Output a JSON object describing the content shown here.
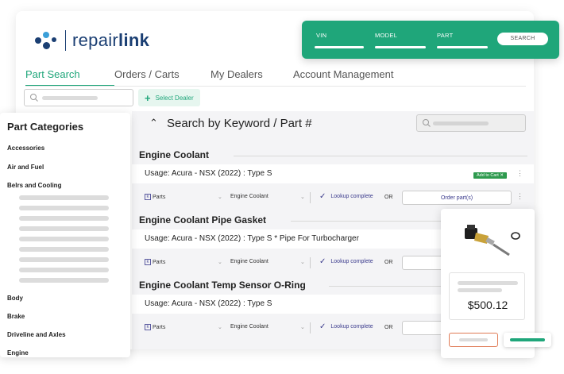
{
  "brand": {
    "name_prefix": "repair",
    "name_suffix": "link"
  },
  "tabs": [
    {
      "label": "Part Search",
      "active": true
    },
    {
      "label": "Orders / Carts",
      "active": false
    },
    {
      "label": "My Dealers",
      "active": false
    },
    {
      "label": "Account Management",
      "active": false
    }
  ],
  "toolbar": {
    "select_dealer_label": "Select Dealer"
  },
  "search_panel": {
    "title": "Search by Keyword / Part #"
  },
  "vin_bar": {
    "vin_label": "VIN",
    "model_label": "MODEL",
    "part_label": "PART",
    "search_button": "SEARCH"
  },
  "results": [
    {
      "title": "Engine Coolant",
      "usage": "Usage: Acura - NSX (2022) : Type S",
      "add_to_cart": "Add to Cart ✕",
      "parts_label": "Parts",
      "category": "Engine Coolant",
      "lookup_status": "Lookup complete",
      "or_label": "OR",
      "order_button": "Order part(s)"
    },
    {
      "title": "Engine Coolant Pipe Gasket",
      "usage": "Usage: Acura - NSX (2022) : Type S * Pipe For Turbocharger",
      "parts_label": "Parts",
      "category": "Engine Coolant",
      "lookup_status": "Lookup complete",
      "or_label": "OR"
    },
    {
      "title": "Engine Coolant Temp Sensor O-Ring",
      "usage": "Usage: Acura - NSX (2022) : Type S",
      "parts_label": "Parts",
      "category": "Engine Coolant",
      "lookup_status": "Lookup complete",
      "or_label": "OR"
    }
  ],
  "categories": {
    "title": "Part Categories",
    "items_top": [
      "Accessories",
      "Air and Fuel",
      "Belrs and Cooling"
    ],
    "items_bottom": [
      "Body",
      "Brake",
      "Driveline and Axles",
      "Engine"
    ]
  },
  "product_card": {
    "price": "$500.12"
  },
  "colors": {
    "brand_green": "#1fa67a",
    "brand_navy": "#1b3f73",
    "accent_orange": "#e07a55",
    "lookup_purple": "#3a3a8c"
  }
}
